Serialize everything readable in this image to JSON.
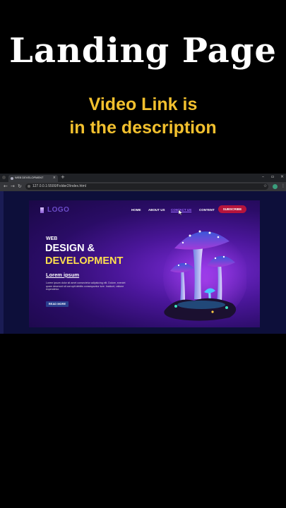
{
  "overlay": {
    "headline": "Landing Page",
    "subline_1": "Video Link is",
    "subline_2": "in the description"
  },
  "browser": {
    "tab_title": "WEB DEVELOPMENT",
    "tab_close": "×",
    "new_tab": "+",
    "window_controls": [
      "–",
      "▫",
      "×"
    ],
    "url": "127.0.0.1:5500/Folder2/index.html",
    "nav_icons": [
      "back-icon",
      "forward-icon",
      "reload-icon"
    ],
    "toolbar_icons": [
      "star-icon",
      "extension-icon",
      "menu-icon"
    ]
  },
  "site": {
    "logo": "LOGO",
    "nav": [
      "HOME",
      "ABOUT US",
      "CONTACT US",
      "CONTENT"
    ],
    "active_nav": "CONTACT US",
    "subscribe": "SUBSCRIBE",
    "hero": {
      "eyebrow": "WEB",
      "title_line1": "DESIGN &",
      "title_line2": "DEVELOPMENT",
      "subtitle": "Lorem ipsum",
      "body": "Lorem ipsum dolor sit amet consectetur adipisicing elit. Dolore, eveniet quam deserunt sit corrupti debitis consequuntur iure. Incidunt, ratione expendetur.",
      "cta": "READ MORE"
    },
    "colors": {
      "accent_yellow": "#ffe04d",
      "subscribe_red": "#b7143c",
      "active_link": "#9a68ff",
      "caption_yellow": "#f2c02e"
    }
  }
}
